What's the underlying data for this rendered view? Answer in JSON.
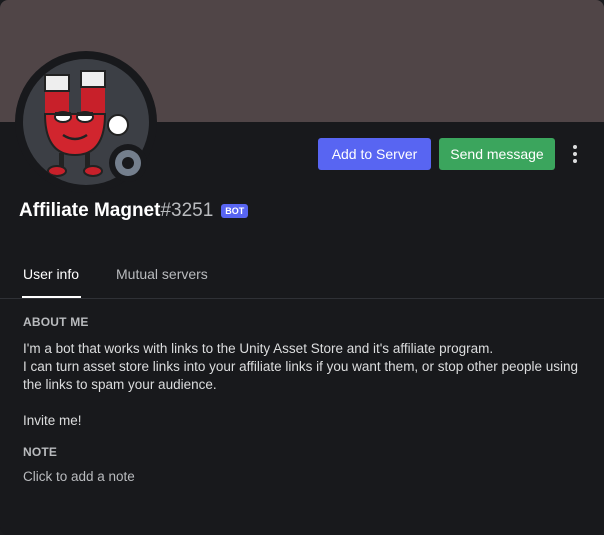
{
  "profile": {
    "username": "Affiliate Magnet",
    "discriminator": "#3251",
    "bot_tag": "BOT",
    "banner_color": "#504547",
    "status": "offline"
  },
  "actions": {
    "add_to_server": "Add to Server",
    "send_message": "Send message",
    "more_icon": "more-vertical-icon"
  },
  "tabs": [
    {
      "label": "User info",
      "active": true
    },
    {
      "label": "Mutual servers",
      "active": false
    }
  ],
  "about": {
    "title": "ABOUT ME",
    "line1": "I'm a bot that works with links to the Unity Asset Store and it's affiliate program.",
    "line2": "I can turn asset store links into your affiliate links if you want them, or stop other people using the links to spam your audience.",
    "line3": "Invite me!"
  },
  "note": {
    "title": "NOTE",
    "placeholder": "Click to add a note"
  },
  "colors": {
    "blurple": "#5865f2",
    "green": "#3ba55d",
    "background": "#18191c"
  }
}
